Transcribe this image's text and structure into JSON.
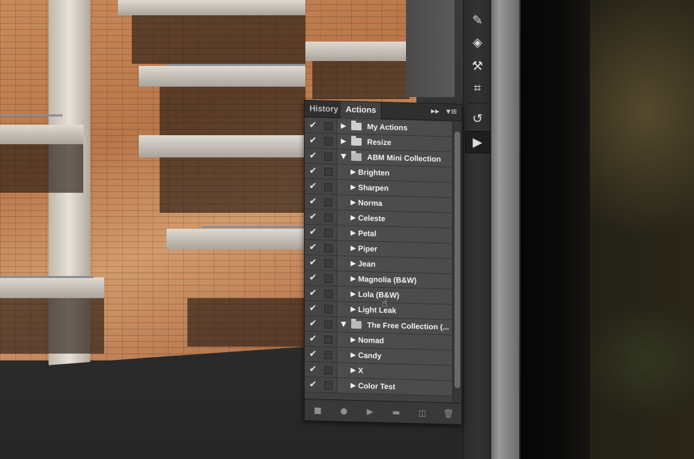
{
  "panel": {
    "tabs": [
      "History",
      "Actions"
    ],
    "active_tab": "Actions",
    "rows": [
      {
        "label": "My Actions",
        "kind": "set",
        "expanded": false
      },
      {
        "label": "Resize",
        "kind": "set",
        "expanded": false
      },
      {
        "label": "ABM Mini Collection",
        "kind": "set",
        "expanded": true
      },
      {
        "label": "Brighten",
        "kind": "action"
      },
      {
        "label": "Sharpen",
        "kind": "action"
      },
      {
        "label": "Norma",
        "kind": "action"
      },
      {
        "label": "Celeste",
        "kind": "action"
      },
      {
        "label": "Petal",
        "kind": "action"
      },
      {
        "label": "Piper",
        "kind": "action"
      },
      {
        "label": "Jean",
        "kind": "action"
      },
      {
        "label": "Magnolia (B&W)",
        "kind": "action"
      },
      {
        "label": "Lola (B&W)",
        "kind": "action"
      },
      {
        "label": "Light Leak",
        "kind": "action"
      },
      {
        "label": "The Free Collection (...",
        "kind": "set",
        "expanded": true
      },
      {
        "label": "Nomad",
        "kind": "action"
      },
      {
        "label": "Candy",
        "kind": "action"
      },
      {
        "label": "X",
        "kind": "action"
      },
      {
        "label": "Color Test",
        "kind": "action"
      }
    ],
    "footer_buttons": [
      "stop-icon",
      "record-icon",
      "play-icon",
      "new-set-icon",
      "new-action-icon",
      "delete-icon"
    ]
  },
  "toolbar_icons": [
    "brush-settings-icon",
    "layers-icon",
    "brush-presets-icon",
    "paths-icon",
    "history-icon",
    "actions-icon"
  ],
  "colors": {
    "panel_bg": "#414141",
    "tab_bar": "#2f2f2f",
    "text": "#f2f2f2"
  }
}
